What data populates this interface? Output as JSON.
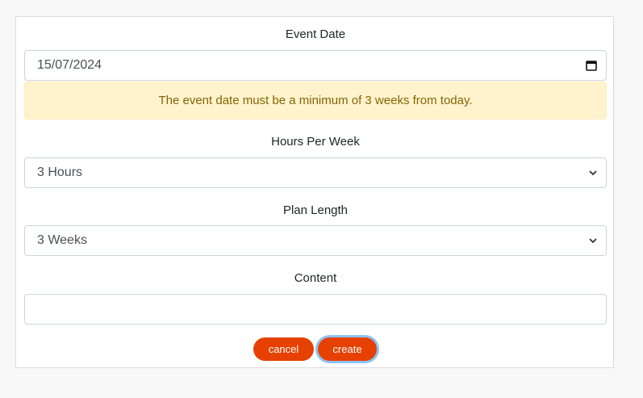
{
  "form": {
    "event_date": {
      "label": "Event Date",
      "value": "15/07/2024",
      "icon": "calendar-icon"
    },
    "alert": {
      "text": "The event date must be a minimum of 3 weeks from today.",
      "color": "#856404",
      "background": "#fff3cd"
    },
    "hours_per_week": {
      "label": "Hours Per Week",
      "selected": "3 Hours"
    },
    "plan_length": {
      "label": "Plan Length",
      "selected": "3 Weeks"
    },
    "content": {
      "label": "Content",
      "value": ""
    },
    "buttons": {
      "cancel_label": "cancel",
      "create_label": "create",
      "accent": "#e64100"
    }
  }
}
